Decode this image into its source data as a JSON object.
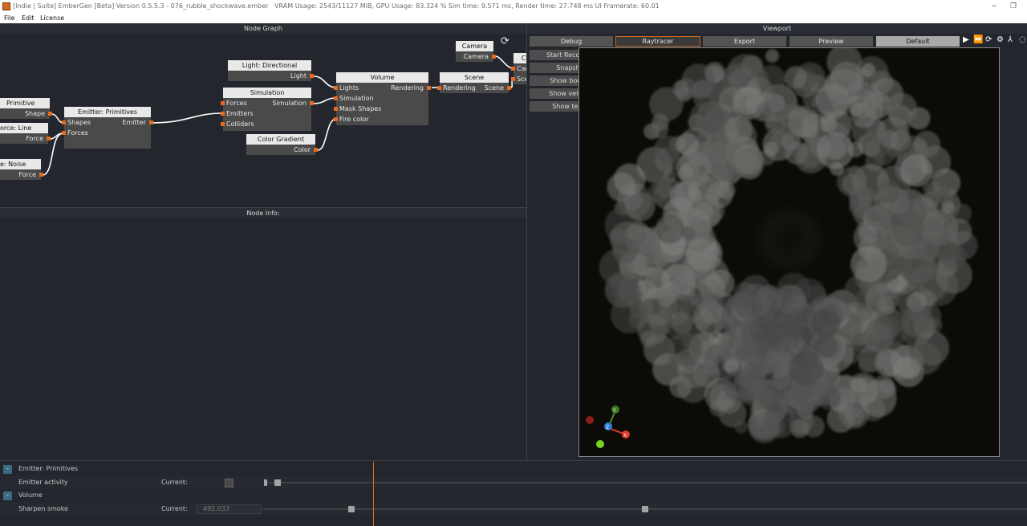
{
  "window": {
    "title": "[Indie | Suite] EmberGen [Beta] Version 0.5.5.3 - 076_rubble_shockwave.ember",
    "stats": "VRAM Usage: 2543/11127 MiB, GPU Usage: 83.324 %   Sim time: 9.571 ms, Render time: 27.748 ms   UI Framerate: 60.01",
    "minimize": "−",
    "restore": "❐"
  },
  "menu": [
    "File",
    "Edit",
    "License"
  ],
  "node_graph": {
    "header": "Node Graph",
    "refresh_icon": "⟳",
    "nodes": {
      "primitive": {
        "title": "Primitive",
        "out": "Shape"
      },
      "force_line": {
        "title": "orce: Line",
        "out": "Force"
      },
      "force_noise": {
        "title": "e: Noise",
        "out": "Force"
      },
      "emitter": {
        "title": "Emitter: Primitives",
        "in1": "Shapes",
        "in2": "Forces",
        "out": "Emitter"
      },
      "light": {
        "title": "Light: Directional",
        "out": "Light"
      },
      "simulation": {
        "title": "Simulation",
        "in1": "Forces",
        "in2": "Emitters",
        "in3": "Colliders",
        "out": "Simulation"
      },
      "color_gradient": {
        "title": "Color Gradient",
        "out": "Color"
      },
      "volume": {
        "title": "Volume",
        "in1": "Lights",
        "in2": "Simulation",
        "in3": "Mask Shapes",
        "in4": "Fire color",
        "out": "Rendering"
      },
      "scene": {
        "title": "Scene",
        "in1": "Rendering",
        "out": "Scene"
      },
      "camera": {
        "title": "Camera",
        "out": "Camera"
      },
      "cam_partial": {
        "title": "Ca",
        "in1": "Cam",
        "in2": "Sce"
      }
    }
  },
  "node_info": {
    "header": "Node Info:"
  },
  "viewport": {
    "header": "Viewport",
    "tabs": [
      "Debug",
      "Raytracer",
      "Export",
      "Preview",
      "Default"
    ],
    "side_buttons": [
      "Start Recording",
      "Snapshot",
      "Show bounds",
      "Show velocity",
      "Show temp."
    ],
    "icons": [
      "play-icon",
      "fast-forward-icon",
      "restart-icon",
      "gear-icon",
      "axes-icon",
      "orbit-icon"
    ],
    "gizmo": {
      "y": "Y",
      "z": "Z",
      "x": "X"
    }
  },
  "timeline": {
    "rows": [
      {
        "type": "group",
        "btn": "-",
        "label": "Emitter: Primitives"
      },
      {
        "type": "param",
        "label": "Emitter activity",
        "current_label": "Current:",
        "value": ""
      },
      {
        "type": "group",
        "btn": "-",
        "label": "Volume"
      },
      {
        "type": "param",
        "label": "Sharpen smoke",
        "current_label": "Current:",
        "value": "492.033"
      }
    ]
  },
  "colors": {
    "accent": "#e86a1e",
    "panel": "#23262d",
    "node_header": "#e9e9e9",
    "node_body": "#4a4a4a"
  }
}
